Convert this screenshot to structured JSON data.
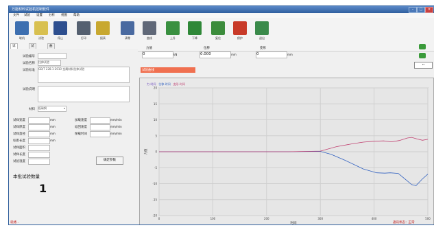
{
  "window": {
    "title": "万能材料试验机控制软件"
  },
  "menu": [
    {
      "label": "文件"
    },
    {
      "label": "试验"
    },
    {
      "label": "设置"
    },
    {
      "label": "分析"
    },
    {
      "label": "视图"
    },
    {
      "label": "帮助"
    }
  ],
  "toolbar": [
    {
      "label": "联机",
      "color": "#3d6fb0"
    },
    {
      "label": "试验",
      "color": "#d8c050"
    },
    {
      "label": "停止",
      "color": "#2e4f8f"
    },
    {
      "label": "打印",
      "color": "#556070"
    },
    {
      "label": "报表",
      "color": "#c8a830"
    },
    {
      "label": "清零",
      "color": "#4a6aa0"
    },
    {
      "label": "曲线",
      "color": "#606878"
    },
    {
      "label": "上升",
      "color": "#3a9040"
    },
    {
      "label": "下降",
      "color": "#2f8838"
    },
    {
      "label": "复位",
      "color": "#3c8c3c"
    },
    {
      "label": "保护",
      "color": "#c83a28"
    },
    {
      "label": "退出",
      "color": "#3a8a4a"
    }
  ],
  "tabs": [
    {
      "label": "试验信息"
    },
    {
      "label": "试验参数"
    },
    {
      "label": "曲线设置"
    }
  ],
  "form": {
    "fields": [
      {
        "label": "试验编号",
        "value": ""
      },
      {
        "label": "试验名称",
        "value": "拉伸试验"
      },
      {
        "label": "试验标准",
        "value": "GB/T 228.1-2010 金属材料拉伸试验"
      },
      {
        "label": "试验说明",
        "value": ""
      }
    ],
    "material_label": "材料",
    "material_value": "低碳钢",
    "params_left": [
      {
        "label": "试样宽度",
        "value": "",
        "unit": "mm"
      },
      {
        "label": "试样厚度",
        "value": "",
        "unit": "mm"
      },
      {
        "label": "试样直径",
        "value": "",
        "unit": "mm"
      },
      {
        "label": "标距长度",
        "value": "",
        "unit": "mm"
      },
      {
        "label": "试样面积",
        "value": "",
        "unit": ""
      },
      {
        "label": "试样长度",
        "value": "",
        "unit": ""
      },
      {
        "label": "试验温度",
        "value": "",
        "unit": ""
      }
    ],
    "params_right": [
      {
        "label": "加载速度",
        "value": "",
        "unit": "mm/min"
      },
      {
        "label": "返回速度",
        "value": "",
        "unit": "mm/min"
      },
      {
        "label": "保载时间",
        "value": "",
        "unit": "mm/min"
      }
    ],
    "apply_button": "确定参数"
  },
  "counter": {
    "label": "本批试验数量",
    "value": "1"
  },
  "readouts": [
    {
      "label": "力值",
      "value": "0",
      "unit": "kN"
    },
    {
      "label": "位移",
      "value": "0.000",
      "unit": "mm"
    },
    {
      "label": "变形",
      "value": "0",
      "unit": "mm"
    }
  ],
  "banner_text": "试验曲线",
  "chart_data": {
    "type": "line",
    "title": "",
    "legend": [
      "力-时间",
      "位移-时间",
      "变形-时间"
    ],
    "xlabel": "时间",
    "ylabel": "力值",
    "grid": true,
    "x_ticks": [
      "0",
      "100",
      "200",
      "300",
      "400",
      "500"
    ],
    "y_ticks": [
      "20",
      "15",
      "10",
      "5",
      "0",
      "-5",
      "-10",
      "-15",
      "-20"
    ],
    "xlim": [
      0,
      500
    ],
    "ylim": [
      -20,
      20
    ],
    "series": [
      {
        "name": "力-时间",
        "color": "#3060c0",
        "points": [
          [
            0,
            0
          ],
          [
            240,
            0
          ],
          [
            300,
            0.1
          ],
          [
            320,
            -0.8
          ],
          [
            345,
            -2.6
          ],
          [
            380,
            -5.4
          ],
          [
            405,
            -6.6
          ],
          [
            420,
            -6.7
          ],
          [
            430,
            -6.6
          ],
          [
            445,
            -6.8
          ],
          [
            455,
            -8.2
          ],
          [
            470,
            -10.3
          ],
          [
            478,
            -10.6
          ],
          [
            490,
            -8.5
          ],
          [
            500,
            -7.0
          ]
        ]
      },
      {
        "name": "位移-时间",
        "color": "#c04070",
        "points": [
          [
            0,
            0
          ],
          [
            240,
            0
          ],
          [
            300,
            0.2
          ],
          [
            330,
            1.6
          ],
          [
            360,
            2.5
          ],
          [
            380,
            3.0
          ],
          [
            400,
            3.3
          ],
          [
            418,
            3.4
          ],
          [
            432,
            3.1
          ],
          [
            447,
            3.5
          ],
          [
            462,
            4.3
          ],
          [
            470,
            4.5
          ],
          [
            480,
            4.0
          ],
          [
            490,
            3.6
          ],
          [
            500,
            3.9
          ]
        ]
      }
    ]
  },
  "status": {
    "left": "就绪...",
    "right": "通讯状态：正常"
  }
}
